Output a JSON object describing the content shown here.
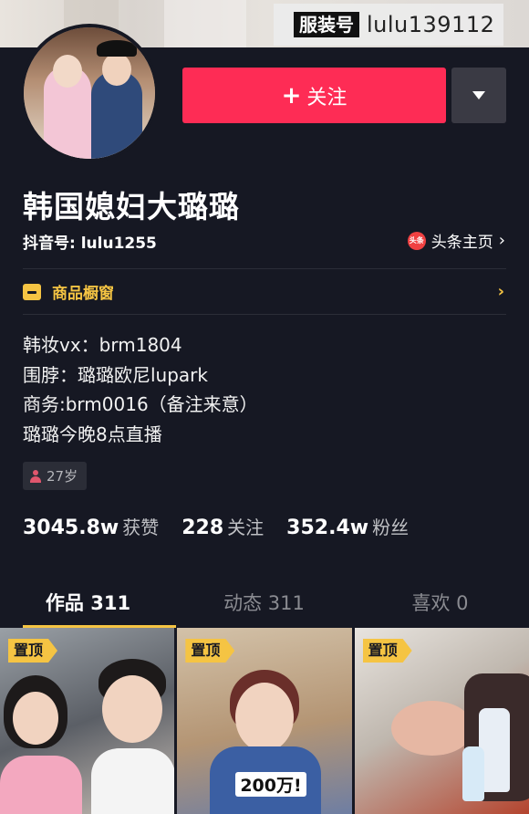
{
  "banner": {
    "tag_key": "服装号",
    "tag_value": "lulu139112"
  },
  "profile": {
    "follow_label": "关注",
    "follow_icon": "plus-icon",
    "more_icon": "caret-down-icon",
    "name": "韩国媳妇大璐璐",
    "douyin_id": "抖音号: lulu1255",
    "toutiao_badge": "头条",
    "toutiao_label": "头条主页",
    "shop_label": "商品橱窗",
    "bio": [
      "韩妆vx：brm1804",
      "围脖：璐璐欧尼lupark",
      "商务:brm0016（备注来意）",
      "璐璐今晚8点直播"
    ],
    "age": "27岁"
  },
  "stats": [
    {
      "value": "3045.8w",
      "label": "获赞"
    },
    {
      "value": "228",
      "label": "关注"
    },
    {
      "value": "352.4w",
      "label": "粉丝"
    }
  ],
  "tabs": [
    {
      "label": "作品 311",
      "active": true
    },
    {
      "label": "动态 311",
      "active": false
    },
    {
      "label": "喜欢 0",
      "active": false
    }
  ],
  "videos": [
    {
      "pin": "置顶",
      "caption": ""
    },
    {
      "pin": "置顶",
      "caption": "200万!"
    },
    {
      "pin": "置顶",
      "caption": ""
    }
  ],
  "colors": {
    "accent": "#fe2c55",
    "background": "#161823",
    "highlight": "#f5c443"
  }
}
